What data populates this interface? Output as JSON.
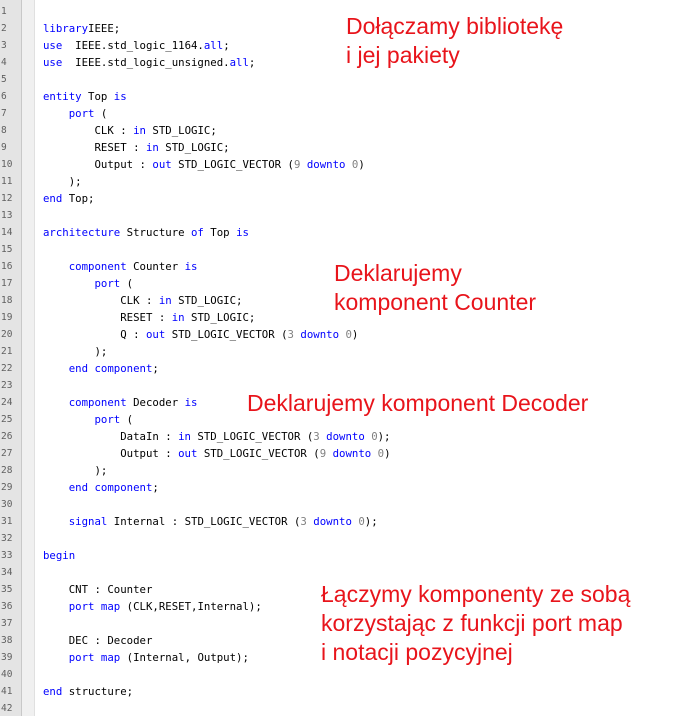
{
  "editor": {
    "lines": [
      {
        "n": "1",
        "t": []
      },
      {
        "n": "2",
        "t": [
          [
            "kw",
            "library"
          ],
          [
            "",
            "IEEE;"
          ]
        ]
      },
      {
        "n": "3",
        "t": [
          [
            "kw",
            "use"
          ],
          [
            "",
            "  IEEE.std_logic_1164."
          ],
          [
            "kw",
            "all"
          ],
          [
            "",
            ";"
          ]
        ]
      },
      {
        "n": "4",
        "t": [
          [
            "kw",
            "use"
          ],
          [
            "",
            "  IEEE.std_logic_unsigned."
          ],
          [
            "kw",
            "all"
          ],
          [
            "",
            ";"
          ]
        ]
      },
      {
        "n": "5",
        "t": []
      },
      {
        "n": "6",
        "t": [
          [
            "kw",
            "entity"
          ],
          [
            "",
            " Top "
          ],
          [
            "kw",
            "is"
          ]
        ]
      },
      {
        "n": "7",
        "t": [
          [
            "",
            "    "
          ],
          [
            "kw",
            "port"
          ],
          [
            "",
            " ("
          ]
        ]
      },
      {
        "n": "8",
        "t": [
          [
            "",
            "        CLK : "
          ],
          [
            "kw",
            "in"
          ],
          [
            "",
            " STD_LOGIC;"
          ]
        ]
      },
      {
        "n": "9",
        "t": [
          [
            "",
            "        RESET : "
          ],
          [
            "kw",
            "in"
          ],
          [
            "",
            " STD_LOGIC;"
          ]
        ]
      },
      {
        "n": "10",
        "t": [
          [
            "",
            "        Output : "
          ],
          [
            "kw",
            "out"
          ],
          [
            "",
            " STD_LOGIC_VECTOR ("
          ],
          [
            "num",
            "9"
          ],
          [
            "",
            " "
          ],
          [
            "kw",
            "downto"
          ],
          [
            "",
            " "
          ],
          [
            "num",
            "0"
          ],
          [
            "",
            ")"
          ]
        ]
      },
      {
        "n": "11",
        "t": [
          [
            "",
            "    );"
          ]
        ]
      },
      {
        "n": "12",
        "t": [
          [
            "kw",
            "end"
          ],
          [
            "",
            " Top;"
          ]
        ]
      },
      {
        "n": "13",
        "t": []
      },
      {
        "n": "14",
        "t": [
          [
            "kw",
            "architecture"
          ],
          [
            "",
            " Structure "
          ],
          [
            "kw",
            "of"
          ],
          [
            "",
            " Top "
          ],
          [
            "kw",
            "is"
          ]
        ]
      },
      {
        "n": "15",
        "t": []
      },
      {
        "n": "16",
        "t": [
          [
            "",
            "    "
          ],
          [
            "kw",
            "component"
          ],
          [
            "",
            " Counter "
          ],
          [
            "kw",
            "is"
          ]
        ]
      },
      {
        "n": "17",
        "t": [
          [
            "",
            "        "
          ],
          [
            "kw",
            "port"
          ],
          [
            "",
            " ("
          ]
        ]
      },
      {
        "n": "18",
        "t": [
          [
            "",
            "            CLK : "
          ],
          [
            "kw",
            "in"
          ],
          [
            "",
            " STD_LOGIC;"
          ]
        ]
      },
      {
        "n": "19",
        "t": [
          [
            "",
            "            RESET : "
          ],
          [
            "kw",
            "in"
          ],
          [
            "",
            " STD_LOGIC;"
          ]
        ]
      },
      {
        "n": "20",
        "t": [
          [
            "",
            "            Q : "
          ],
          [
            "kw",
            "out"
          ],
          [
            "",
            " STD_LOGIC_VECTOR ("
          ],
          [
            "num",
            "3"
          ],
          [
            "",
            " "
          ],
          [
            "kw",
            "downto"
          ],
          [
            "",
            " "
          ],
          [
            "num",
            "0"
          ],
          [
            "",
            ")"
          ]
        ]
      },
      {
        "n": "21",
        "t": [
          [
            "",
            "        );"
          ]
        ]
      },
      {
        "n": "22",
        "t": [
          [
            "",
            "    "
          ],
          [
            "kw",
            "end"
          ],
          [
            "",
            " "
          ],
          [
            "kw",
            "component"
          ],
          [
            "",
            ";"
          ]
        ]
      },
      {
        "n": "23",
        "t": []
      },
      {
        "n": "24",
        "t": [
          [
            "",
            "    "
          ],
          [
            "kw",
            "component"
          ],
          [
            "",
            " Decoder "
          ],
          [
            "kw",
            "is"
          ]
        ]
      },
      {
        "n": "25",
        "t": [
          [
            "",
            "        "
          ],
          [
            "kw",
            "port"
          ],
          [
            "",
            " ("
          ]
        ]
      },
      {
        "n": "26",
        "t": [
          [
            "",
            "            DataIn : "
          ],
          [
            "kw",
            "in"
          ],
          [
            "",
            " STD_LOGIC_VECTOR ("
          ],
          [
            "num",
            "3"
          ],
          [
            "",
            " "
          ],
          [
            "kw",
            "downto"
          ],
          [
            "",
            " "
          ],
          [
            "num",
            "0"
          ],
          [
            "",
            ");"
          ]
        ]
      },
      {
        "n": "27",
        "t": [
          [
            "",
            "            Output : "
          ],
          [
            "kw",
            "out"
          ],
          [
            "",
            " STD_LOGIC_VECTOR ("
          ],
          [
            "num",
            "9"
          ],
          [
            "",
            " "
          ],
          [
            "kw",
            "downto"
          ],
          [
            "",
            " "
          ],
          [
            "num",
            "0"
          ],
          [
            "",
            ")"
          ]
        ]
      },
      {
        "n": "28",
        "t": [
          [
            "",
            "        );"
          ]
        ]
      },
      {
        "n": "29",
        "t": [
          [
            "",
            "    "
          ],
          [
            "kw",
            "end"
          ],
          [
            "",
            " "
          ],
          [
            "kw",
            "component"
          ],
          [
            "",
            ";"
          ]
        ]
      },
      {
        "n": "30",
        "t": []
      },
      {
        "n": "31",
        "t": [
          [
            "",
            "    "
          ],
          [
            "kw",
            "signal"
          ],
          [
            "",
            " Internal : STD_LOGIC_VECTOR ("
          ],
          [
            "num",
            "3"
          ],
          [
            "",
            " "
          ],
          [
            "kw",
            "downto"
          ],
          [
            "",
            " "
          ],
          [
            "num",
            "0"
          ],
          [
            "",
            ");"
          ]
        ]
      },
      {
        "n": "32",
        "t": []
      },
      {
        "n": "33",
        "t": [
          [
            "kw",
            "begin"
          ]
        ]
      },
      {
        "n": "34",
        "t": []
      },
      {
        "n": "35",
        "t": [
          [
            "",
            "    CNT : Counter"
          ]
        ]
      },
      {
        "n": "36",
        "t": [
          [
            "",
            "    "
          ],
          [
            "kw",
            "port map"
          ],
          [
            "",
            " (CLK,RESET,Internal);"
          ]
        ]
      },
      {
        "n": "37",
        "t": []
      },
      {
        "n": "38",
        "t": [
          [
            "",
            "    DEC : Decoder"
          ]
        ]
      },
      {
        "n": "39",
        "t": [
          [
            "",
            "    "
          ],
          [
            "kw",
            "port map"
          ],
          [
            "",
            " (Internal, Output);"
          ]
        ]
      },
      {
        "n": "40",
        "t": []
      },
      {
        "n": "41",
        "t": [
          [
            "kw",
            "end"
          ],
          [
            "",
            " structure;"
          ]
        ]
      },
      {
        "n": "42",
        "t": []
      }
    ]
  },
  "annotations": {
    "library": "Dołączamy bibliotekę\ni jej pakiety",
    "counter": "Deklarujemy\nkomponent Counter",
    "decoder": "Deklarujemy komponent Decoder",
    "connect": "Łączymy komponenty ze sobą\nkorzystając z funkcji port map\ni notacji pozycyjnej"
  },
  "colors": {
    "keyword": "#0000ff",
    "number": "#808080",
    "annotation": "#e8141b"
  }
}
